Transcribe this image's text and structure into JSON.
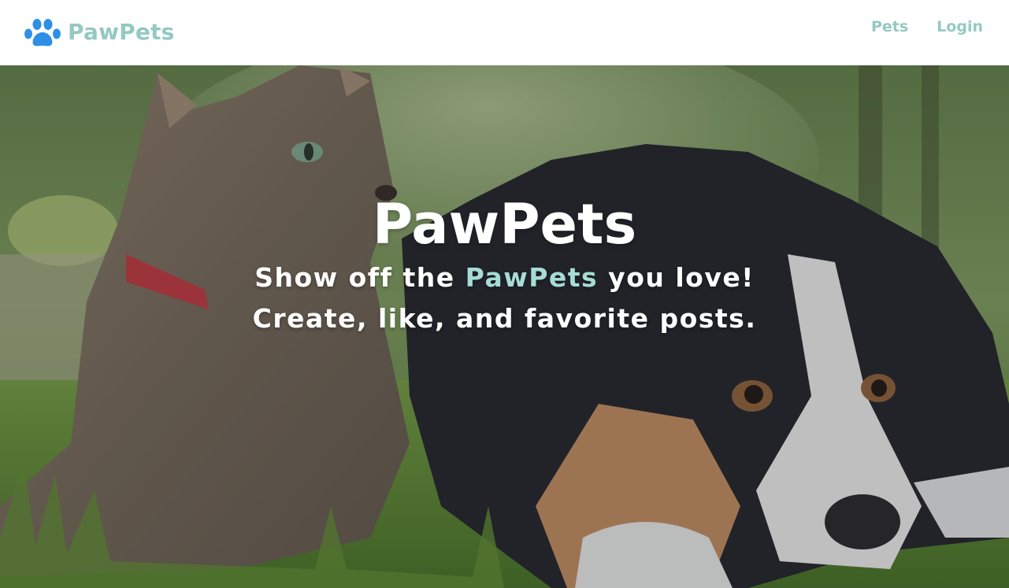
{
  "nav": {
    "brand_name": "PawPets",
    "links": [
      {
        "label": "Pets"
      },
      {
        "label": "Login"
      }
    ]
  },
  "hero": {
    "title": "PawPets",
    "line1_prefix": "Show off the ",
    "line1_accent": "PawPets",
    "line1_suffix": " you love!",
    "line2": "Create, like, and favorite posts.",
    "image_description_icon": "cat-and-dog-photo"
  },
  "colors": {
    "brand": "#94c9c1",
    "paw_icon": "#2f8fe6",
    "accent_text": "#a6dcd3",
    "nav_bg": "#ffffff",
    "hero_text": "#ffffff"
  }
}
